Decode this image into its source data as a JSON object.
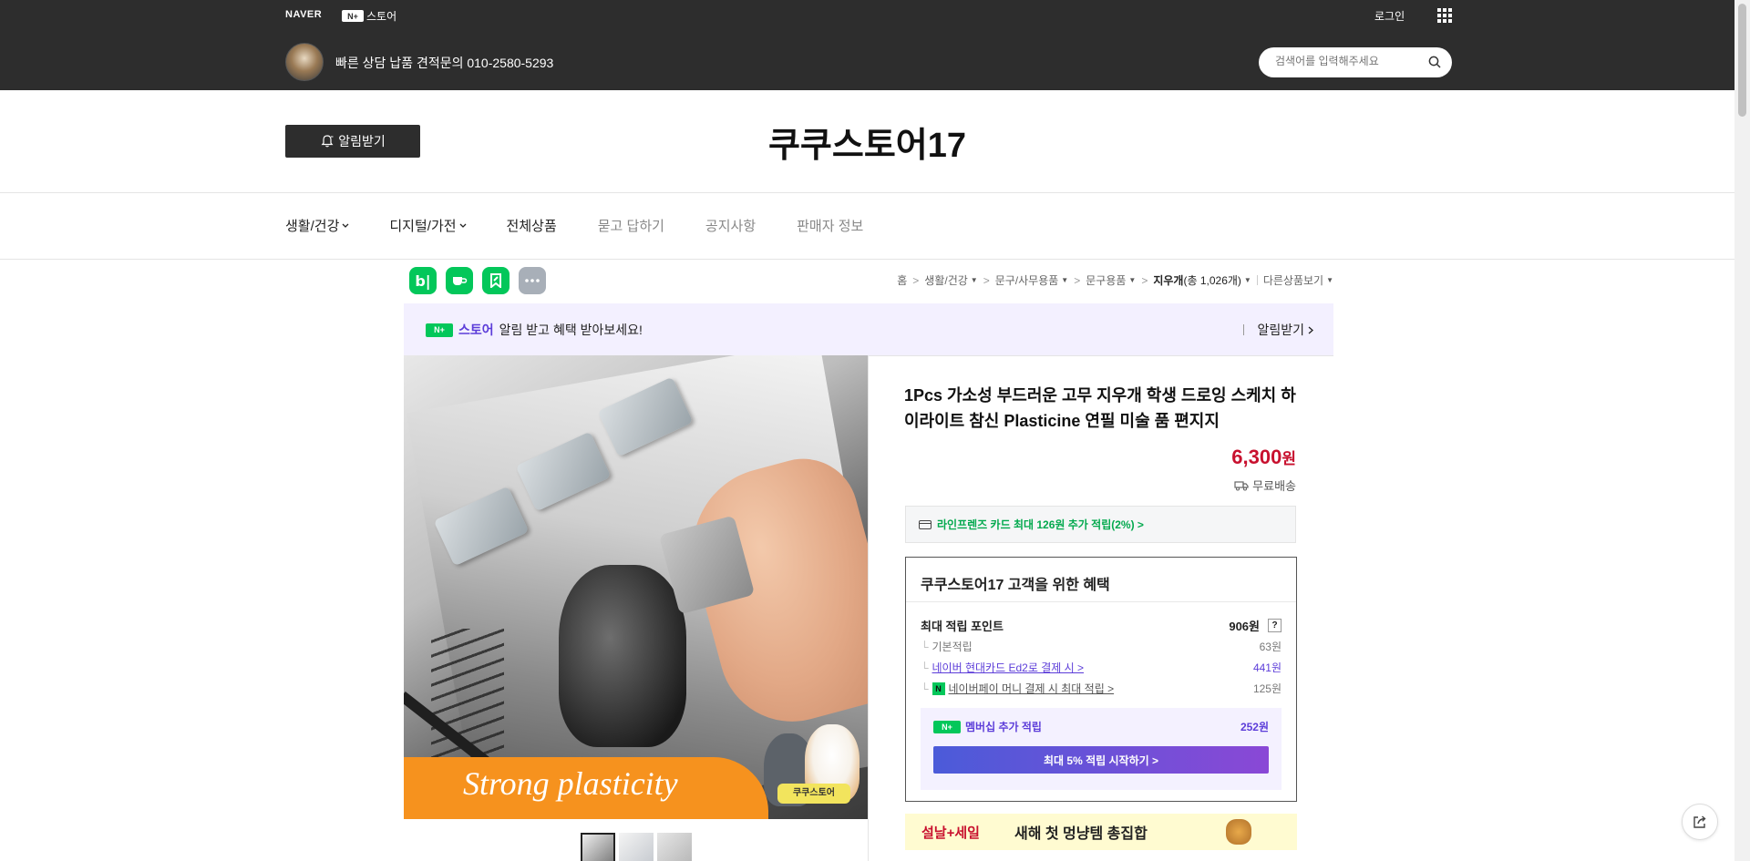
{
  "header": {
    "naver_logo": "NAVER",
    "nstore_badge": "N+",
    "nstore_label": "스토어",
    "login": "로그인",
    "tagline": "빠른 상담 납품 견적문의 010-2580-5293",
    "search_placeholder": "검색어를 입력해주세요"
  },
  "store": {
    "notify_button": "알림받기",
    "name": "쿠쿠스토어17"
  },
  "nav": {
    "items": [
      {
        "label": "생활/건강",
        "caret": true
      },
      {
        "label": "디지털/가전",
        "caret": true
      },
      {
        "label": "전체상품"
      },
      {
        "label": "묻고 답하기"
      },
      {
        "label": "공지사항"
      },
      {
        "label": "판매자 정보"
      }
    ]
  },
  "share_icons": [
    {
      "name": "blog-icon",
      "glyph": "b|",
      "color": "#03c75a"
    },
    {
      "name": "cafe-icon",
      "glyph": "☕",
      "color": "#03c75a"
    },
    {
      "name": "bookmark-icon",
      "glyph": "✎",
      "color": "#03c75a"
    },
    {
      "name": "more-icon",
      "glyph": "•••",
      "color": "#a8afb8"
    }
  ],
  "breadcrumb": {
    "home": "홈",
    "c1": "생활/건강",
    "c2": "문구/사무용품",
    "c3": "문구용품",
    "c4": "지우개",
    "c4_count": "(총 1,026개)",
    "other": "다른상품보기"
  },
  "promo": {
    "badge": "N+",
    "store_word": "스토어",
    "text": "알림 받고 혜택 받아보세요!",
    "action": "알림받기"
  },
  "image": {
    "overlay_text": "Strong plasticity",
    "cat_label": "쿠쿠스토어"
  },
  "product": {
    "title": "1Pcs 가소성 부드러운 고무 지우개 학생 드로잉 스케치 하이라이트 참신 Plasticine 연필 미술 품 편지지",
    "price": "6,300",
    "price_unit": "원",
    "shipping": "무료배송",
    "card_benefit": "라인프렌즈 카드 최대 126원 추가 적립(2%) >"
  },
  "benefits": {
    "title": "쿠쿠스토어17 고객을 위한 혜택",
    "max_points_label": "최대 적립 포인트",
    "max_points_value": "906원",
    "question": "?",
    "rows": [
      {
        "label": "기본적립",
        "value": "63원"
      },
      {
        "label": "네이버 현대카드 Ed2로 결제 시 >",
        "value": "441원"
      },
      {
        "label": "네이버페이 머니 결제 시 최대 적립 >",
        "value": "125원",
        "badge": "N"
      }
    ],
    "membership": {
      "badge": "N+",
      "label": "멤버십 추가 적립",
      "value": "252원",
      "cta": "최대 5% 적립 시작하기 >"
    }
  },
  "sale_banner": {
    "tag": "설날+세일",
    "text": "새해 첫 멍냥템 총집합"
  },
  "colors": {
    "header_bg": "#2d2d2d",
    "price_red": "#c8102e",
    "naver_green": "#03c75a",
    "purple": "#5c3dd9",
    "promo_bg": "#f3f0ff"
  }
}
